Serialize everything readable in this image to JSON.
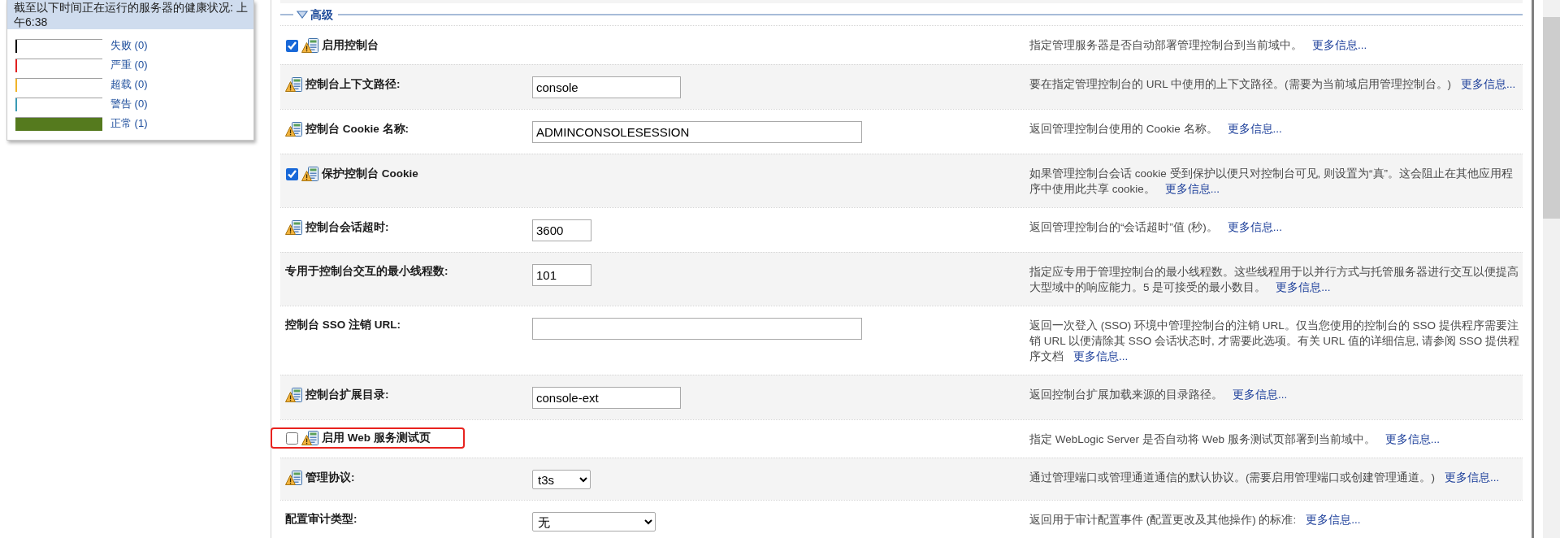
{
  "health_panel": {
    "title": "截至以下时间正在运行的服务器的健康状况: 上午6:38",
    "legend": [
      {
        "label": "失败 (0)",
        "color": "#000000",
        "level": 0
      },
      {
        "label": "严重 (0)",
        "color": "#e02020",
        "level": 0
      },
      {
        "label": "超载 (0)",
        "color": "#f0b429",
        "level": 0
      },
      {
        "label": "警告 (0)",
        "color": "#3a9bb5",
        "level": 0
      },
      {
        "label": "正常 (1)",
        "color": "#557a1e",
        "level": 1
      }
    ]
  },
  "section": {
    "title": "高级",
    "expanded": true
  },
  "rows": [
    {
      "kind": "checkbox",
      "label": "启用控制台",
      "checked": true,
      "warning_icon": true,
      "highlighted": false,
      "description": "指定管理服务器是否自动部署管理控制台到当前域中。",
      "more_link": "更多信息..."
    },
    {
      "kind": "text",
      "label": "控制台上下文路径:",
      "value": "console",
      "warning_icon": true,
      "highlighted": false,
      "description": "要在指定管理控制台的 URL 中使用的上下文路径。(需要为当前域启用管理控制台。)",
      "more_link": "更多信息..."
    },
    {
      "kind": "text",
      "label": "控制台 Cookie 名称:",
      "value": "ADMINCONSOLESESSION",
      "warning_icon": true,
      "highlighted": false,
      "description": "返回管理控制台使用的 Cookie 名称。",
      "more_link": "更多信息..."
    },
    {
      "kind": "checkbox",
      "label": "保护控制台 Cookie",
      "checked": true,
      "warning_icon": true,
      "highlighted": false,
      "description": "如果管理控制台会话 cookie 受到保护以便只对控制台可见, 则设置为“真”。这会阻止在其他应用程序中使用此共享 cookie。",
      "more_link": "更多信息..."
    },
    {
      "kind": "text",
      "label": "控制台会话超时:",
      "value": "3600",
      "warning_icon": true,
      "highlighted": false,
      "description": "返回管理控制台的“会话超时”值 (秒)。",
      "more_link": "更多信息..."
    },
    {
      "kind": "text",
      "label": "专用于控制台交互的最小线程数:",
      "value": "101",
      "warning_icon": false,
      "highlighted": false,
      "description": "指定应专用于管理控制台的最小线程数。这些线程用于以并行方式与托管服务器进行交互以便提高大型域中的响应能力。5 是可接受的最小数目。",
      "more_link": "更多信息..."
    },
    {
      "kind": "text",
      "label": "控制台 SSO 注销 URL:",
      "warning_icon": false,
      "highlighted": false,
      "description": "返回一次登入 (SSO) 环境中管理控制台的注销 URL。仅当您使用的控制台的 SSO 提供程序需要注销 URL 以便清除其 SSO 会话状态时, 才需要此选项。有关 URL 值的详细信息, 请参阅 SSO 提供程序文档",
      "more_link": "更多信息..."
    },
    {
      "kind": "text",
      "label": "控制台扩展目录:",
      "value": "console-ext",
      "warning_icon": true,
      "highlighted": false,
      "description": "返回控制台扩展加载来源的目录路径。",
      "more_link": "更多信息..."
    },
    {
      "kind": "checkbox",
      "label": "启用 Web 服务测试页",
      "checked": false,
      "warning_icon": true,
      "highlighted": true,
      "description": "指定 WebLogic Server 是否自动将 Web 服务测试页部署到当前域中。",
      "more_link": "更多信息..."
    },
    {
      "kind": "select",
      "label": "管理协议:",
      "value": "t3s",
      "warning_icon": true,
      "highlighted": false,
      "description": "通过管理端口或管理通道通信的默认协议。(需要启用管理端口或创建管理通道。)",
      "more_link": "更多信息..."
    },
    {
      "kind": "select",
      "label": "配置审计类型:",
      "value": "无",
      "warning_icon": false,
      "highlighted": false,
      "description": "返回用于审计配置事件 (配置更改及其他操作) 的标准:",
      "more_link": "更多信息..."
    }
  ]
}
